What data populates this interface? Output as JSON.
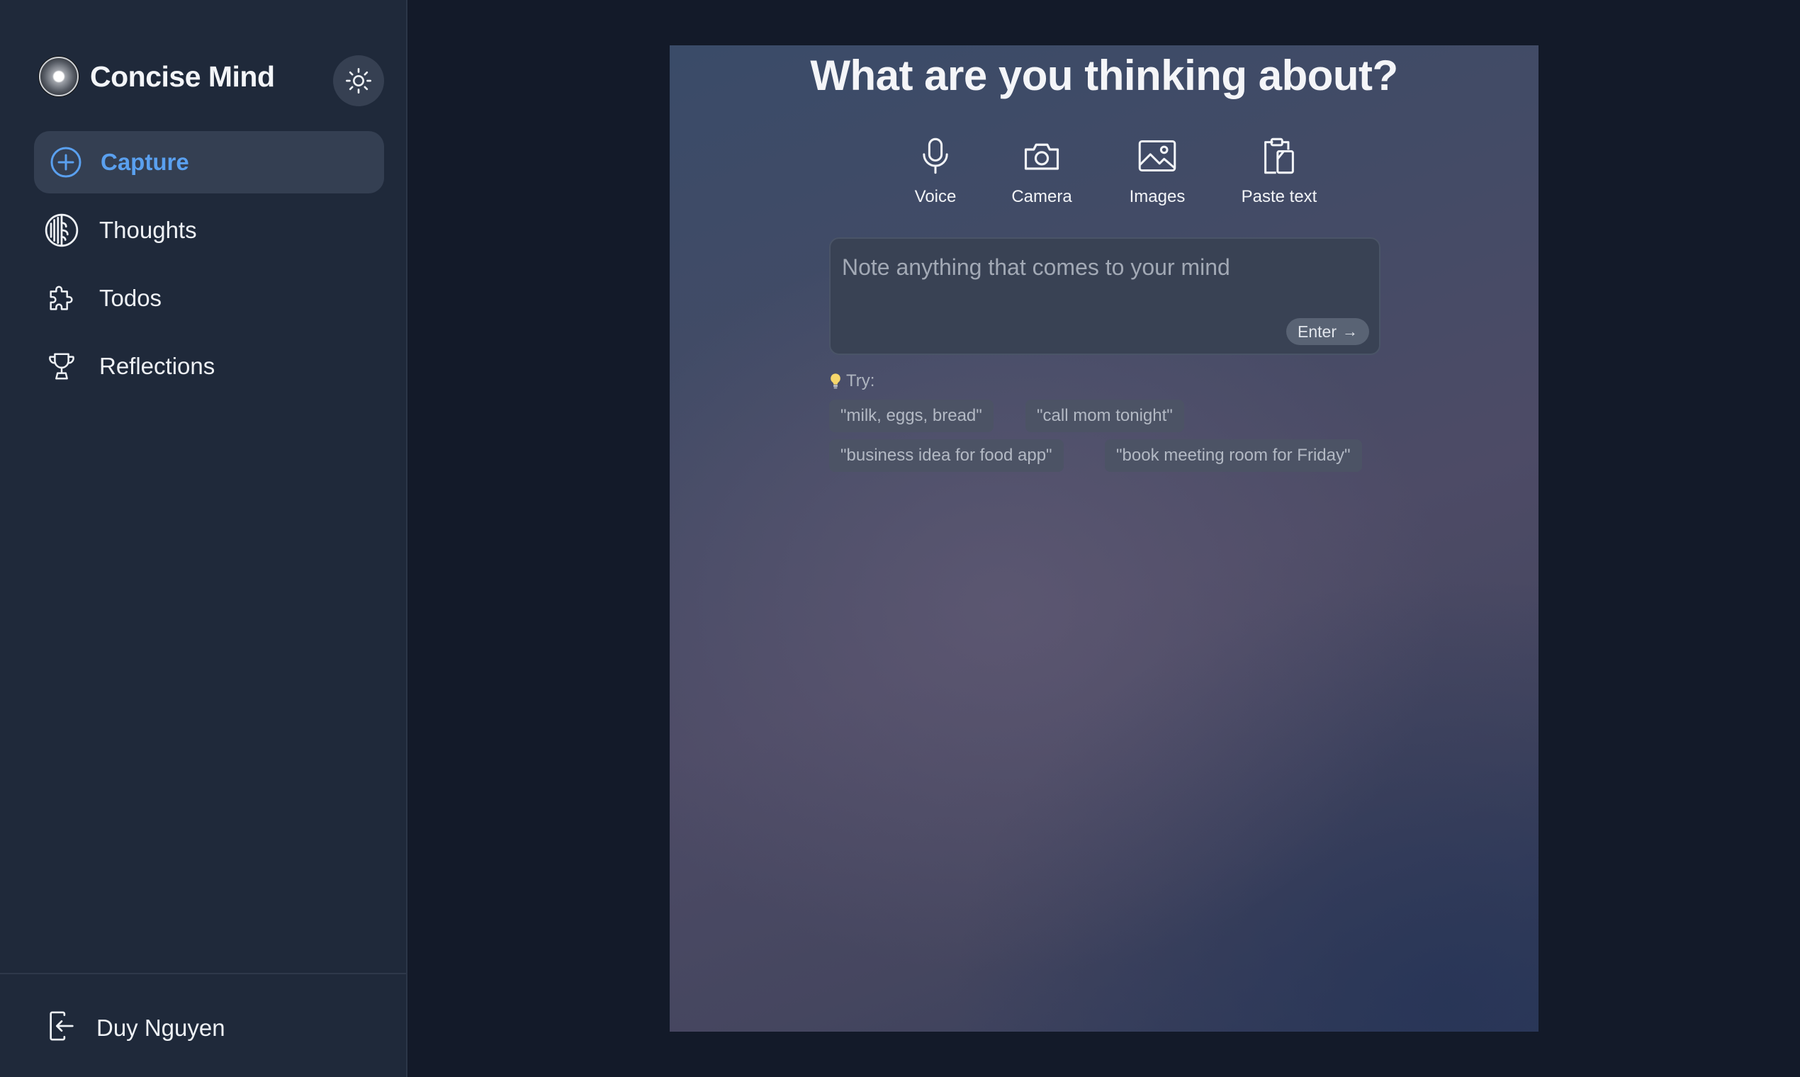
{
  "brand": {
    "name": "Concise Mind"
  },
  "sidebar": {
    "items": [
      {
        "label": "Capture",
        "icon": "plus-circle-icon",
        "active": true
      },
      {
        "label": "Thoughts",
        "icon": "brain-icon",
        "active": false
      },
      {
        "label": "Todos",
        "icon": "puzzle-icon",
        "active": false
      },
      {
        "label": "Reflections",
        "icon": "trophy-icon",
        "active": false
      }
    ],
    "user": {
      "name": "Duy Nguyen",
      "icon": "logout-icon"
    }
  },
  "main": {
    "headline": "What are you thinking about?",
    "actions": [
      {
        "label": "Voice",
        "icon": "microphone-icon"
      },
      {
        "label": "Camera",
        "icon": "camera-icon"
      },
      {
        "label": "Images",
        "icon": "image-icon"
      },
      {
        "label": "Paste text",
        "icon": "clipboard-icon"
      }
    ],
    "note": {
      "placeholder": "Note anything that comes to your mind",
      "value": "",
      "enter_label": "Enter",
      "enter_arrow": "→"
    },
    "try_label": "Try:",
    "suggestions": [
      "\"milk, eggs, bread\"",
      "\"call mom tonight\"",
      "\"business idea for food app\"",
      "\"book meeting room for Friday\""
    ]
  },
  "colors": {
    "accent": "#5aa0ef",
    "sidebar_bg": "#1f293a",
    "page_bg": "#131a29"
  }
}
